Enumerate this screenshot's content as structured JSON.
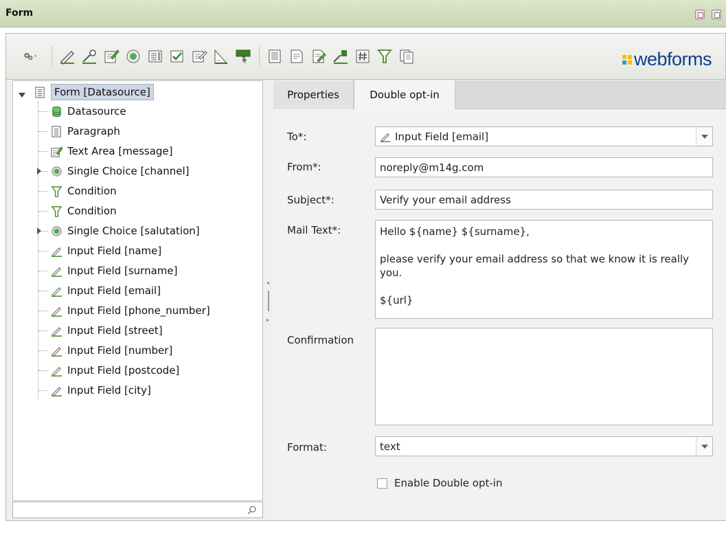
{
  "window": {
    "title": "Form"
  },
  "toolbar": {
    "icons": [
      "gears-menu-icon",
      "input-field-icon",
      "password-field-icon",
      "text-area-icon",
      "single-choice-icon",
      "select-box-icon",
      "checkbox-icon",
      "edit-icon",
      "layout-icon",
      "button-icon",
      "paragraph-icon",
      "document-icon",
      "document-edit-icon",
      "upload-field-icon",
      "number-field-icon",
      "condition-filter-icon",
      "copy-icon"
    ],
    "logo_text": "webforms"
  },
  "tree": {
    "root": "Form [Datasource]",
    "items": [
      {
        "label": "Datasource",
        "icon": "database-icon",
        "expandable": false
      },
      {
        "label": "Paragraph",
        "icon": "paragraph-icon",
        "expandable": false
      },
      {
        "label": "Text Area [message]",
        "icon": "text-area-icon",
        "expandable": false
      },
      {
        "label": "Single Choice [channel]",
        "icon": "single-choice-icon",
        "expandable": true
      },
      {
        "label": "Condition",
        "icon": "condition-filter-icon",
        "expandable": false
      },
      {
        "label": "Condition",
        "icon": "condition-filter-icon",
        "expandable": false
      },
      {
        "label": "Single Choice [salutation]",
        "icon": "single-choice-icon",
        "expandable": true
      },
      {
        "label": "Input Field [name]",
        "icon": "input-field-icon",
        "expandable": false
      },
      {
        "label": "Input Field [surname]",
        "icon": "input-field-icon",
        "expandable": false
      },
      {
        "label": "Input Field [email]",
        "icon": "input-field-icon",
        "expandable": false
      },
      {
        "label": "Input Field [phone_number]",
        "icon": "input-field-icon",
        "expandable": false
      },
      {
        "label": "Input Field [street]",
        "icon": "input-field-icon",
        "expandable": false
      },
      {
        "label": "Input Field [number]",
        "icon": "input-field-icon",
        "expandable": false
      },
      {
        "label": "Input Field [postcode]",
        "icon": "input-field-icon",
        "expandable": false
      },
      {
        "label": "Input Field [city]",
        "icon": "input-field-icon",
        "expandable": false
      }
    ],
    "search_value": ""
  },
  "tabs": [
    {
      "label": "Properties",
      "active": false
    },
    {
      "label": "Double opt-in",
      "active": true
    }
  ],
  "form": {
    "to_label": "To*:",
    "to_value": "Input Field [email]",
    "from_label": "From*:",
    "from_value": "noreply@m14g.com",
    "subject_label": "Subject*:",
    "subject_value": "Verify your email address",
    "mail_text_label": "Mail Text*:",
    "mail_text_value": "Hello ${name} ${surname},\n\nplease verify your email address so that we know it is really you.\n\n${url}",
    "confirmation_label": "Confirmation",
    "confirmation_value": "",
    "format_label": "Format:",
    "format_value": "text",
    "enable_label": "Enable Double opt-in",
    "enable_checked": false
  }
}
